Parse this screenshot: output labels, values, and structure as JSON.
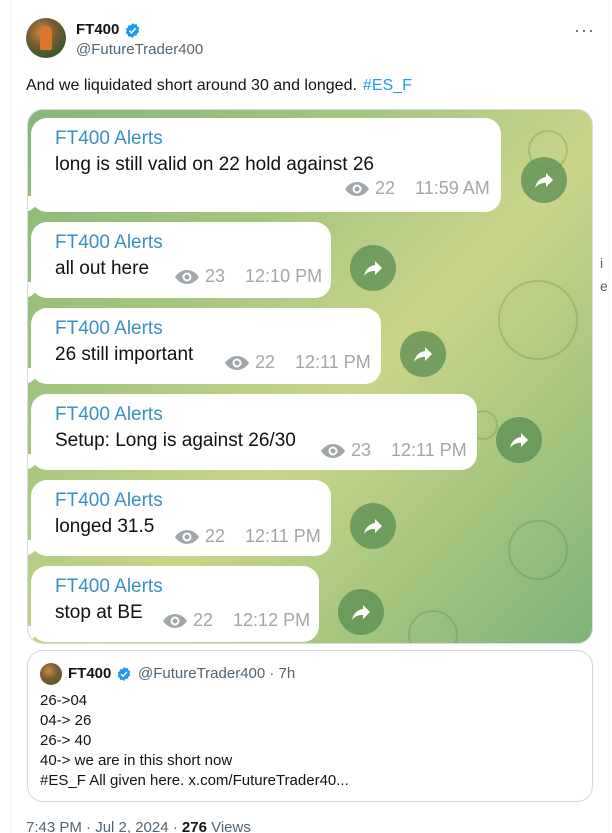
{
  "author": {
    "name": "FT400",
    "handle": "@FutureTrader400"
  },
  "more_label": "···",
  "tweet": {
    "text": "And we liquidated short around 30 and longed.",
    "hashtag": "#ES_F"
  },
  "messages": [
    {
      "sender": "FT400 Alerts",
      "text": "long is still valid on 22 hold against 26",
      "views": "22",
      "time": "11:59 AM"
    },
    {
      "sender": "FT400 Alerts",
      "text": "all out here",
      "views": "23",
      "time": "12:10 PM"
    },
    {
      "sender": "FT400 Alerts",
      "text": "26 still important",
      "views": "22",
      "time": "12:11 PM"
    },
    {
      "sender": "FT400 Alerts",
      "text": "Setup: Long is against 26/30",
      "views": "23",
      "time": "12:11 PM"
    },
    {
      "sender": "FT400 Alerts",
      "text": "longed 31.5",
      "views": "22",
      "time": "12:11 PM"
    },
    {
      "sender": "FT400 Alerts",
      "text": "stop at BE",
      "views": "22",
      "time": "12:12 PM"
    }
  ],
  "quote": {
    "name": "FT400",
    "handle_time": "@FutureTrader400 · 7h",
    "lines": [
      "26->04",
      "04-> 26",
      "26-> 40",
      "40-> we are in this short now",
      "#ES_F All given here. x.com/FutureTrader40..."
    ]
  },
  "footer": {
    "time": "7:43 PM · Jul 2, 2024 · ",
    "views_count": "276",
    "views_label": " Views"
  },
  "edge_fragments": {
    "f1": "i",
    "f2": "e"
  },
  "colors": {
    "link": "#1d9bf0",
    "verified": "#1d9bf0",
    "sender": "#3a8fc6",
    "forward_button": "#588c50"
  },
  "icons": {
    "verified": "verified-badge-icon",
    "views": "eye-icon",
    "forward": "forward-arrow-icon",
    "more": "more-dots-icon"
  }
}
